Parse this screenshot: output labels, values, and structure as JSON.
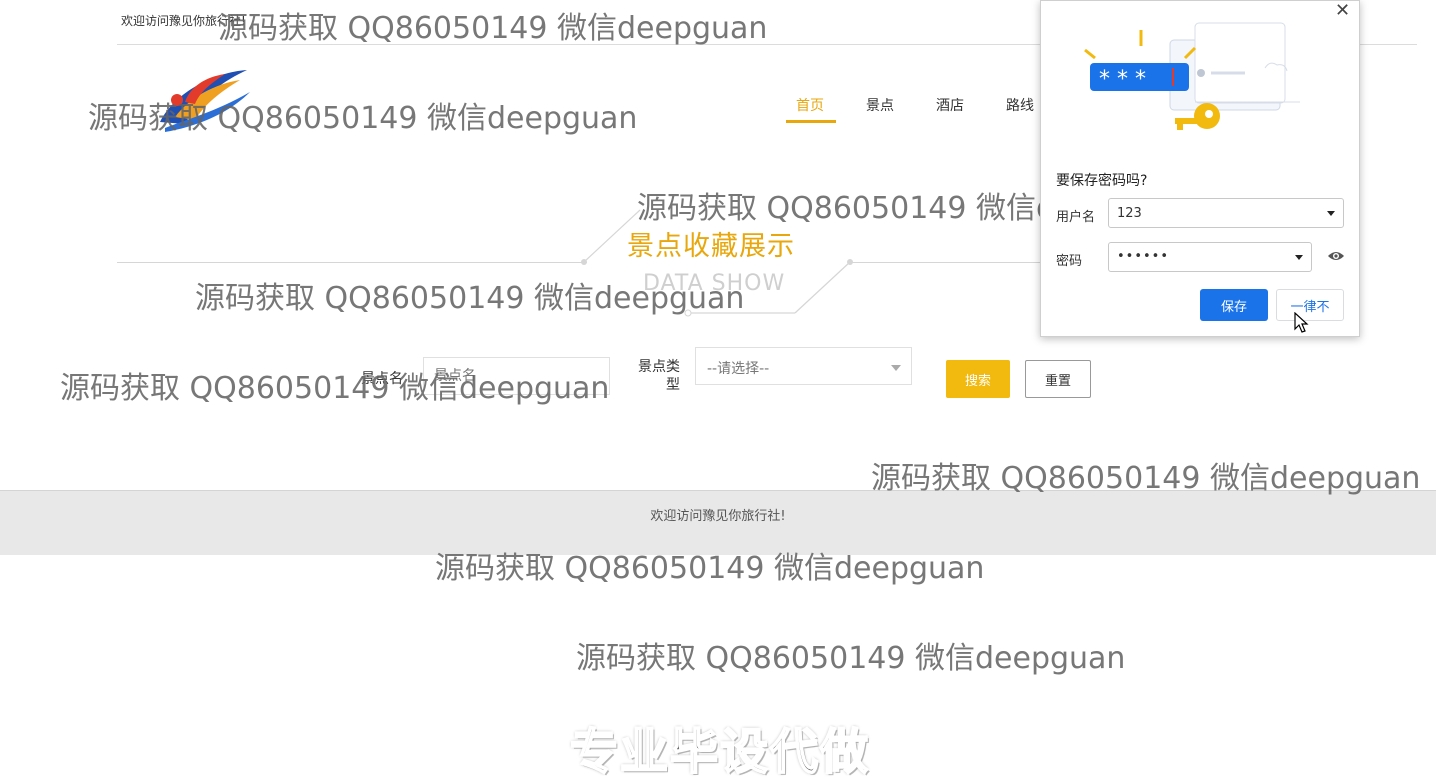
{
  "header": {
    "welcome": "欢迎访问豫见你旅行社!",
    "nav": [
      {
        "label": "首页",
        "active": true
      },
      {
        "label": "景点",
        "active": false
      },
      {
        "label": "酒店",
        "active": false
      },
      {
        "label": "路线",
        "active": false
      }
    ]
  },
  "section": {
    "title": "景点收藏展示",
    "subtitle": "DATA SHOW"
  },
  "search": {
    "name_label": "景点名",
    "name_placeholder": "景点名",
    "type_label": "景点类型",
    "type_value": "--请选择--",
    "search_button": "搜索",
    "reset_button": "重置"
  },
  "footer": {
    "text": "欢迎访问豫见你旅行社!"
  },
  "password_popup": {
    "question": "要保存密码吗?",
    "username_label": "用户名",
    "username_value": "123",
    "password_label": "密码",
    "password_value": "••••••",
    "save_button": "保存",
    "never_button": "一律不",
    "illustration_mask": "* * *"
  },
  "watermark": "源码获取 QQ86050149 微信deepguan",
  "promo": "专业毕设代做",
  "colors": {
    "accent": "#e8a70c",
    "search_button": "#f2b90f",
    "popup_primary": "#1a73e8"
  }
}
